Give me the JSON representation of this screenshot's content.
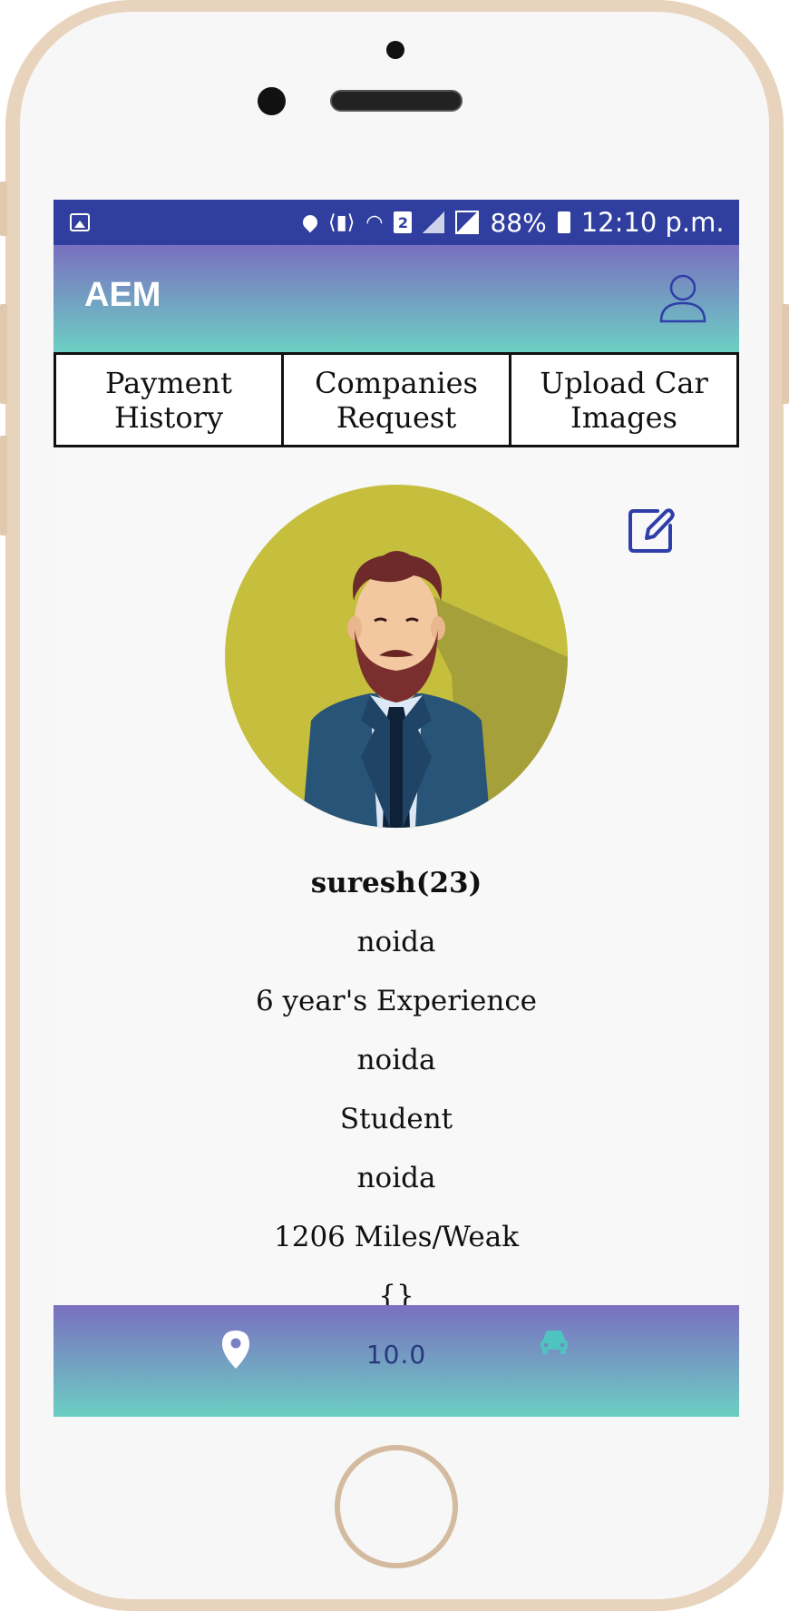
{
  "statusbar": {
    "sim_label": "2",
    "battery_pct": "88%",
    "time": "12:10 p.m.",
    "icons": [
      "gallery-icon",
      "location-icon",
      "vibrate-icon",
      "wifi-icon",
      "sim-icon",
      "signal-icon",
      "battery-icon"
    ]
  },
  "appbar": {
    "title": "AEM",
    "user_icon": "user-icon"
  },
  "tabs": [
    {
      "label": "Payment History"
    },
    {
      "label": "Companies Request"
    },
    {
      "label": "Upload Car Images"
    }
  ],
  "profile": {
    "name": "suresh(23)",
    "line1": "noida",
    "experience": "6 year's Experience",
    "line3": "noida",
    "occupation": "Student",
    "line5": "noida",
    "distance": "1206 Miles/Weak",
    "extra": "{}"
  },
  "bottombar": {
    "value": "10.0",
    "left_icon": "location-icon",
    "right_icon": "car-icon"
  },
  "colors": {
    "statusbar": "#303f9f",
    "gradient_top": "#7a6fc0",
    "gradient_bottom": "#6ccfc3",
    "avatar_bg": "#c5bf3d",
    "accent": "#2f3ea8"
  }
}
